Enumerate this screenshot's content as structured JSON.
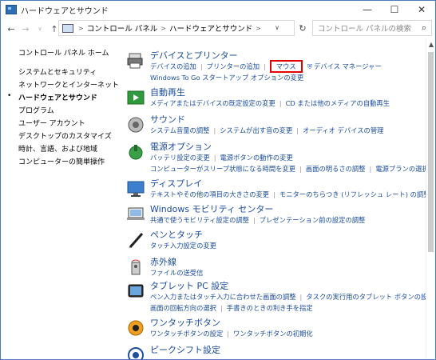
{
  "window": {
    "title": "ハードウェアとサウンド",
    "minimize": "—",
    "maximize": "☐",
    "close": "✕"
  },
  "addressbar": {
    "back": "←",
    "forward": "→",
    "up": "↑",
    "breadcrumb": [
      "コントロール パネル",
      "ハードウェアとサウンド"
    ],
    "sep": ">",
    "dropdown": "∨",
    "refresh": "↻",
    "search_placeholder": "コントロール パネルの検索",
    "search_icon": "⌕"
  },
  "sidebar": {
    "items": [
      {
        "label": "コントロール パネル ホーム"
      },
      {
        "label": "システムとセキュリティ"
      },
      {
        "label": "ネットワークとインターネット"
      },
      {
        "label": "ハードウェアとサウンド"
      },
      {
        "label": "プログラム"
      },
      {
        "label": "ユーザー アカウント"
      },
      {
        "label": "デスクトップのカスタマイズ"
      },
      {
        "label": "時計、言語、および地域"
      },
      {
        "label": "コンピューターの簡単操作"
      }
    ],
    "bullet": "•"
  },
  "categories": [
    {
      "title": "デバイスとプリンター",
      "lines": [
        [
          "デバイスの追加",
          "プリンターの追加",
          "マウス",
          "デバイス マネージャー"
        ],
        [
          "Windows To Go スタートアップ オプションの変更"
        ]
      ]
    },
    {
      "title": "自動再生",
      "lines": [
        [
          "メディアまたはデバイスの既定設定の変更",
          "CD または他のメディアの自動再生"
        ]
      ]
    },
    {
      "title": "サウンド",
      "lines": [
        [
          "システム音量の調整",
          "システムが出す音の変更",
          "オーディオ デバイスの管理"
        ]
      ]
    },
    {
      "title": "電源オプション",
      "lines": [
        [
          "バッテリ設定の変更",
          "電源ボタンの動作の変更"
        ],
        [
          "コンピューターがスリープ状態になる時間を変更",
          "画面の明るさの調整",
          "電源プランの選択"
        ]
      ]
    },
    {
      "title": "ディスプレイ",
      "lines": [
        [
          "テキストやその他の項目の大きさの変更",
          "モニターのちらつき (リフレッシュ レート) の調整方法"
        ]
      ]
    },
    {
      "title": "Windows モビリティ センター",
      "lines": [
        [
          "共通で使うモビリティ設定の調整",
          "プレゼンテーション前の設定の調整"
        ]
      ]
    },
    {
      "title": "ペンとタッチ",
      "lines": [
        [
          "タッチ入力設定の変更"
        ]
      ]
    },
    {
      "title": "赤外線",
      "lines": [
        [
          "ファイルの送受信"
        ]
      ]
    },
    {
      "title": "タブレット PC 設定",
      "lines": [
        [
          "ペン入力またはタッチ入力に合わせた画面の調整",
          "タスクの実行用のタブレット ボタンの設定"
        ],
        [
          "画面の回転方向の選択",
          "手書きのときの利き手を指定"
        ]
      ]
    },
    {
      "title": "ワンタッチボタン",
      "lines": [
        [
          "ワンタッチボタンの設定",
          "ワンタッチボタンの初期化"
        ]
      ]
    },
    {
      "title": "ピークシフト設定",
      "lines": []
    }
  ],
  "colors": {
    "link": "#1a4c9e",
    "highlight": "#e00000"
  },
  "icons": {
    "devices": "printer-icon",
    "autoplay": "autoplay-icon",
    "sound": "speaker-icon",
    "power": "power-icon",
    "display": "monitor-icon",
    "mobility": "mobility-icon",
    "pen": "pen-icon",
    "infrared": "infrared-icon",
    "tablet": "tablet-icon",
    "onetouch": "onetouch-icon",
    "peakshift": "peakshift-icon"
  }
}
